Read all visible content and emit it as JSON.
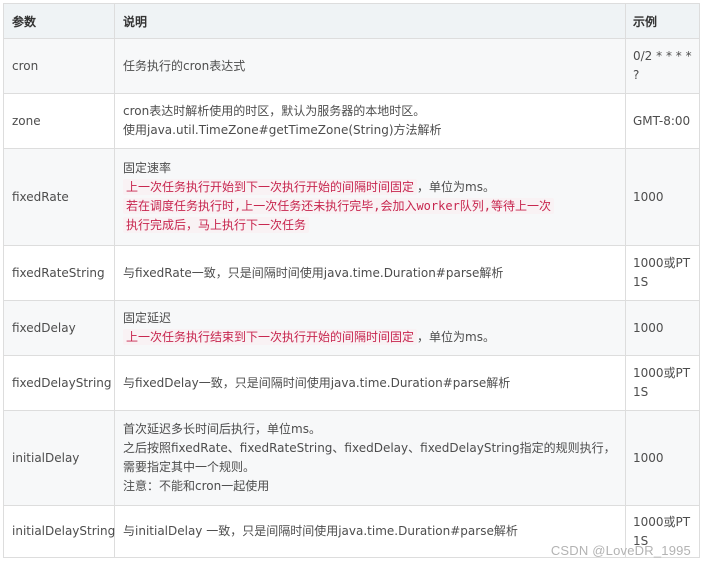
{
  "table": {
    "headers": {
      "param": "参数",
      "desc": "说明",
      "example": "示例"
    },
    "rows": [
      {
        "param": "cron",
        "desc": [
          "任务执行的cron表达式"
        ],
        "example": "0/2 * * * * ?"
      },
      {
        "param": "zone",
        "desc": [
          "cron表达时解析使用的时区，默认为服务器的本地时区。",
          "使用java.util.TimeZone#getTimeZone(String)方法解析"
        ],
        "example": "GMT-8:00"
      },
      {
        "param": "fixedRate",
        "desc_title": "固定速率",
        "desc_hl1": "上一次任务执行开始到下一次执行开始的间隔时间固定",
        "desc_tail1": "，单位为ms。",
        "desc_hl2a": "若在调度任务执行时,上一次任务还未执行完毕,会加入worker队列,等待上一次",
        "desc_hl2b": "执行完成后，马上执行下一次任务",
        "example": "1000"
      },
      {
        "param": "fixedRateString",
        "desc": [
          "与fixedRate一致，只是间隔时间使用java.time.Duration#parse解析"
        ],
        "example": "1000或PT1S"
      },
      {
        "param": "fixedDelay",
        "desc_title": "固定延迟",
        "desc_hl1": "上一次任务执行结束到下一次执行开始的间隔时间固定",
        "desc_tail1": "，单位为ms。",
        "example": "1000"
      },
      {
        "param": "fixedDelayString",
        "desc": [
          "与fixedDelay一致，只是间隔时间使用java.time.Duration#parse解析"
        ],
        "example": "1000或PT1S"
      },
      {
        "param": "initialDelay",
        "desc": [
          "首次延迟多长时间后执行，单位ms。",
          "之后按照fixedRate、fixedRateString、fixedDelay、fixedDelayString指定的规则执行，需要指定其中一个规则。",
          "注意：不能和cron一起使用"
        ],
        "example": "1000"
      },
      {
        "param": "initialDelayString",
        "desc": [
          "与initialDelay 一致，只是间隔时间使用java.time.Duration#parse解析"
        ],
        "example": "1000或PT1S"
      }
    ]
  },
  "watermark": "CSDN @LoveDR_1995"
}
